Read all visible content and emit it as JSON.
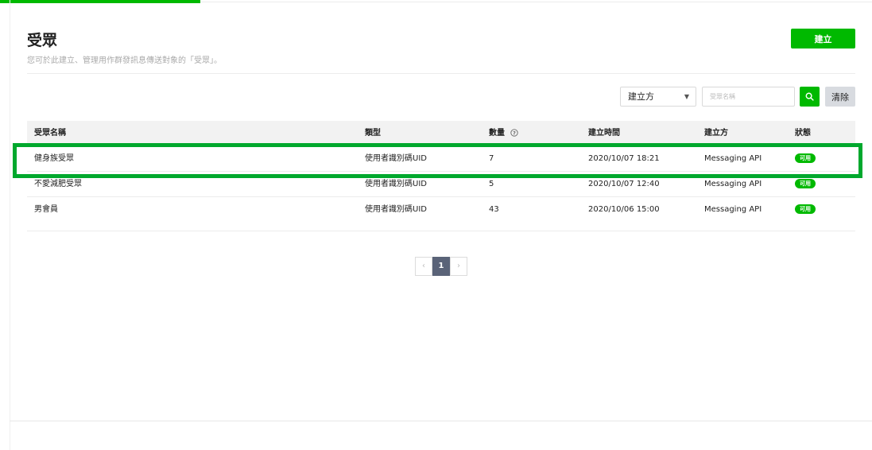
{
  "header": {
    "title": "受眾",
    "subtitle": "您可於此建立、管理用作群發訊息傳送對象的「受眾」。",
    "create_label": "建立"
  },
  "filters": {
    "creator_select": {
      "selected": "建立方"
    },
    "search": {
      "placeholder": "受眾名稱",
      "value": ""
    },
    "search_icon": "search-icon",
    "clear_label": "清除"
  },
  "table": {
    "columns": [
      "受眾名稱",
      "類型",
      "數量",
      "建立時間",
      "建立方",
      "狀態"
    ],
    "rows": [
      {
        "name": "健身族受眾",
        "type": "使用者識別碼UID",
        "count": "7",
        "created_at": "2020/10/07 18:21",
        "creator": "Messaging API",
        "status": "可用"
      },
      {
        "name": "不愛減肥受眾",
        "type": "使用者識別碼UID",
        "count": "5",
        "created_at": "2020/10/07 12:40",
        "creator": "Messaging API",
        "status": "可用"
      },
      {
        "name": "男會員",
        "type": "使用者識別碼UID",
        "count": "43",
        "created_at": "2020/10/06 15:00",
        "creator": "Messaging API",
        "status": "可用"
      }
    ]
  },
  "pagination": {
    "prev": "‹",
    "current": "1",
    "next": "›"
  },
  "colors": {
    "accent": "#00b900",
    "highlight": "#00a82d",
    "page_active": "#5a6378"
  }
}
